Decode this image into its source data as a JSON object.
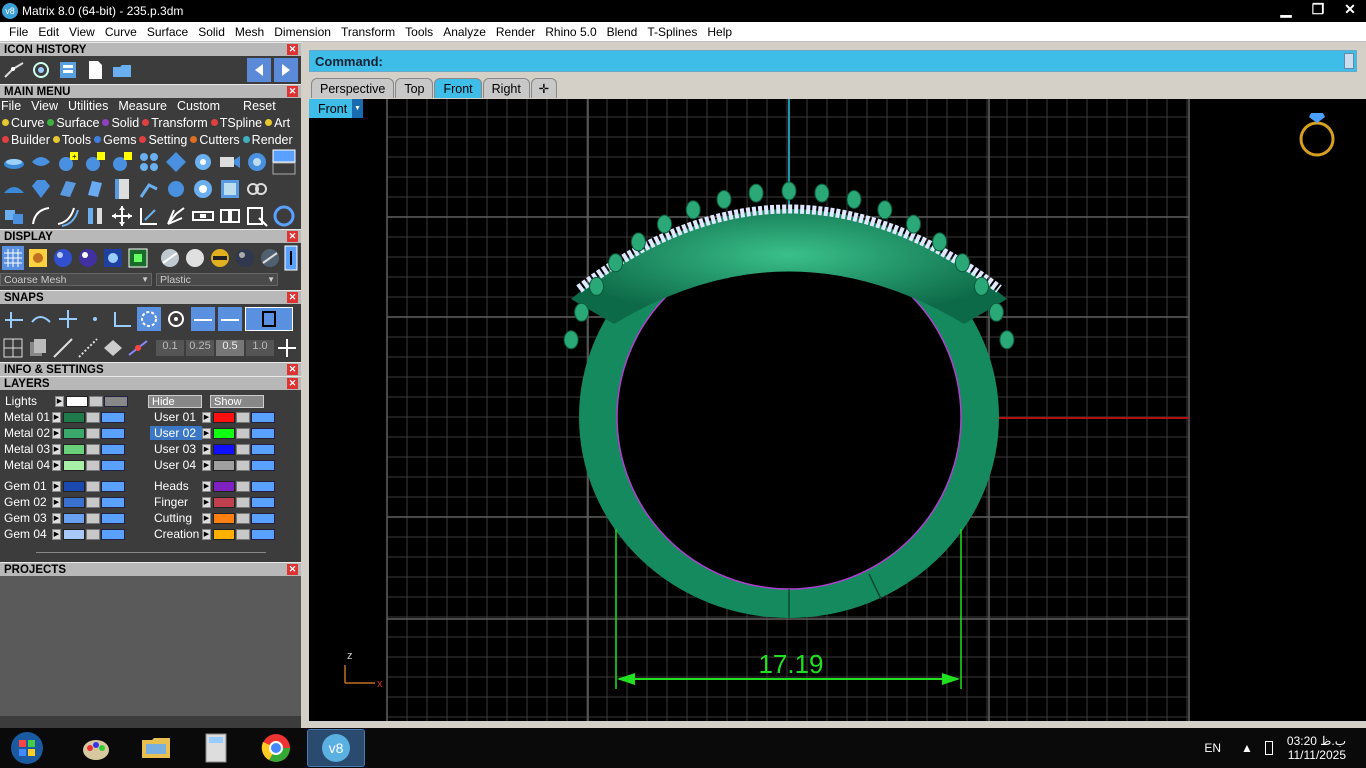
{
  "window": {
    "title": "Matrix 8.0 (64-bit) - 235.p.3dm",
    "minimize_glyph": "▁",
    "maximize_glyph": "❐",
    "close_glyph": "✕",
    "app_icon_text": "v8"
  },
  "menubar": [
    "File",
    "Edit",
    "View",
    "Curve",
    "Surface",
    "Solid",
    "Mesh",
    "Dimension",
    "Transform",
    "Tools",
    "Analyze",
    "Render",
    "Rhino 5.0",
    "Blend",
    "T-Splines",
    "Help"
  ],
  "panels": {
    "icon_history": "ICON HISTORY",
    "main_menu": "MAIN MENU",
    "display": "DISPLAY",
    "snaps": "SNAPS",
    "info_settings": "INFO & SETTINGS",
    "layers": "LAYERS",
    "projects": "PROJECTS",
    "close_glyph": "✕"
  },
  "main_menu": {
    "menu": [
      "File",
      "View",
      "Utilities",
      "Measure",
      "Custom"
    ],
    "reset": "Reset",
    "cats_row1": [
      {
        "label": "Curve",
        "color": "#e8c830"
      },
      {
        "label": "Surface",
        "color": "#40b040"
      },
      {
        "label": "Solid",
        "color": "#9040c0"
      },
      {
        "label": "Transform",
        "color": "#e04040"
      },
      {
        "label": "TSpline",
        "color": "#e04040"
      },
      {
        "label": "Art",
        "color": "#e8c830"
      }
    ],
    "cats_row2": [
      {
        "label": "Builder",
        "color": "#e04040"
      },
      {
        "label": "Tools",
        "color": "#e8c830"
      },
      {
        "label": "Gems",
        "color": "#4080e0"
      },
      {
        "label": "Setting",
        "color": "#e04040"
      },
      {
        "label": "Cutters",
        "color": "#e07020"
      },
      {
        "label": "Render",
        "color": "#40b0c0"
      }
    ]
  },
  "display": {
    "mesh_select": "Coarse Mesh",
    "material_select": "Plastic"
  },
  "snaps": {
    "values": [
      "0.1",
      "0.25",
      "0.5",
      "1.0"
    ]
  },
  "layers": {
    "lights": "Lights",
    "hide": "Hide",
    "show": "Show",
    "left": [
      {
        "name": "Metal 01",
        "color": "#1e7a4a"
      },
      {
        "name": "Metal 02",
        "color": "#3aa86a"
      },
      {
        "name": "Metal 03",
        "color": "#6ad07a"
      },
      {
        "name": "Metal 04",
        "color": "#a8f0a8"
      },
      {
        "name": "Gem 01",
        "color": "#1a4ab0"
      },
      {
        "name": "Gem 02",
        "color": "#3a70d0"
      },
      {
        "name": "Gem 03",
        "color": "#6aa0f0"
      },
      {
        "name": "Gem 04",
        "color": "#a8c8f8"
      }
    ],
    "right": [
      {
        "name": "User 01",
        "color": "#ff1010"
      },
      {
        "name": "User 02",
        "color": "#10ff10",
        "selected": true
      },
      {
        "name": "User 03",
        "color": "#1010ff"
      },
      {
        "name": "User 04",
        "color": "#a0a0a0"
      },
      {
        "name": "Heads",
        "color": "#8020c0"
      },
      {
        "name": "Finger",
        "color": "#c04050"
      },
      {
        "name": "Cutting",
        "color": "#ff8010"
      },
      {
        "name": "Creation",
        "color": "#ffb000"
      }
    ]
  },
  "command": {
    "label": "Command:"
  },
  "viewport_tabs": [
    "Perspective",
    "Top",
    "Front",
    "Right"
  ],
  "active_tab": "Front",
  "viewport": {
    "label": "Front",
    "dimension": "17.19",
    "axis_z": "z",
    "axis_x": "x"
  },
  "taskbar": {
    "lang": "EN",
    "time": "03:20 ب.ظ",
    "date": "11/11/2025",
    "matrix_icon": "v8"
  }
}
